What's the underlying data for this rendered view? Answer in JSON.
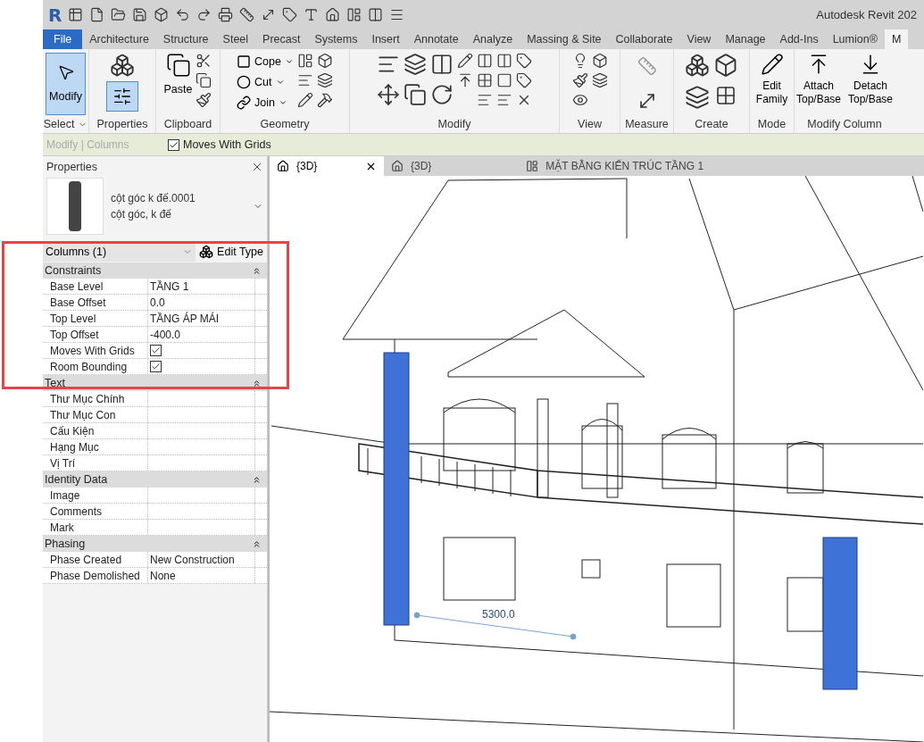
{
  "app": {
    "logo": "R",
    "title": "Autodesk Revit 202"
  },
  "ribbon_tabs": [
    {
      "label": "File",
      "kind": "file",
      "selected": false
    },
    {
      "label": "Architecture",
      "kind": "tab",
      "selected": false
    },
    {
      "label": "Structure",
      "kind": "tab",
      "selected": false
    },
    {
      "label": "Steel",
      "kind": "tab",
      "selected": false
    },
    {
      "label": "Precast",
      "kind": "tab",
      "selected": false
    },
    {
      "label": "Systems",
      "kind": "tab",
      "selected": false
    },
    {
      "label": "Insert",
      "kind": "tab",
      "selected": false
    },
    {
      "label": "Annotate",
      "kind": "tab",
      "selected": false
    },
    {
      "label": "Analyze",
      "kind": "tab",
      "selected": false
    },
    {
      "label": "Massing & Site",
      "kind": "tab",
      "selected": false
    },
    {
      "label": "Collaborate",
      "kind": "tab",
      "selected": false
    },
    {
      "label": "View",
      "kind": "tab",
      "selected": false
    },
    {
      "label": "Manage",
      "kind": "tab",
      "selected": false
    },
    {
      "label": "Add-Ins",
      "kind": "tab",
      "selected": false
    },
    {
      "label": "Lumion®",
      "kind": "tab",
      "selected": false
    },
    {
      "label": "M",
      "kind": "tab",
      "selected": true
    }
  ],
  "ribbon": {
    "modify_button": {
      "label": "Modify",
      "selected": true
    },
    "properties_button": {
      "selected": true
    },
    "paste_button": {
      "label": "Paste"
    },
    "geometry_tools": [
      "Cope",
      "Cut",
      "Join"
    ],
    "edit_family_button": {
      "label": "Edit\nFamily"
    },
    "column_buttons": [
      {
        "label": "Attach\nTop/Base"
      },
      {
        "label": "Detach\nTop/Base"
      }
    ],
    "panel_labels": [
      "Select",
      "Properties",
      "Clipboard",
      "Geometry",
      "Modify",
      "View",
      "Measure",
      "Create",
      "Mode",
      "Modify Column"
    ]
  },
  "context_bar": {
    "label": "Modify | Columns",
    "option": {
      "label": "Moves With Grids",
      "checked": true
    }
  },
  "properties": {
    "title": "Properties",
    "type_lines": [
      "cột góc k đế.0001",
      "cột góc, k đế"
    ],
    "selector": "Columns (1)",
    "edit_type": "Edit Type",
    "groups": [
      {
        "name": "Constraints",
        "expanded": true,
        "rows": [
          {
            "name": "Base Level",
            "kind": "text",
            "value": "TẦNG 1"
          },
          {
            "name": "Base Offset",
            "kind": "text",
            "value": "0.0"
          },
          {
            "name": "Top Level",
            "kind": "text",
            "value": "TẦNG ÁP MÁI"
          },
          {
            "name": "Top Offset",
            "kind": "text",
            "value": "-400.0"
          },
          {
            "name": "Moves With Grids",
            "kind": "check",
            "checked": true
          },
          {
            "name": "Room Bounding",
            "kind": "check",
            "checked": true
          }
        ]
      },
      {
        "name": "Text",
        "expanded": true,
        "rows": [
          {
            "name": "Thư Mục Chính",
            "kind": "text",
            "value": ""
          },
          {
            "name": "Thư Mục Con",
            "kind": "text",
            "value": ""
          },
          {
            "name": "Cấu Kiện",
            "kind": "text",
            "value": ""
          },
          {
            "name": "Hạng Mục",
            "kind": "text",
            "value": ""
          },
          {
            "name": "Vị Trí",
            "kind": "text",
            "value": ""
          }
        ]
      },
      {
        "name": "Identity Data",
        "expanded": true,
        "rows": [
          {
            "name": "Image",
            "kind": "text",
            "value": ""
          },
          {
            "name": "Comments",
            "kind": "text",
            "value": ""
          },
          {
            "name": "Mark",
            "kind": "text",
            "value": ""
          }
        ]
      },
      {
        "name": "Phasing",
        "expanded": true,
        "rows": [
          {
            "name": "Phase Created",
            "kind": "text",
            "value": "New Construction"
          },
          {
            "name": "Phase Demolished",
            "kind": "text",
            "value": "None"
          }
        ]
      }
    ]
  },
  "view_tabs": [
    {
      "label": "{3D}",
      "kind": "model",
      "selected": true
    },
    {
      "label": "{3D}",
      "kind": "model",
      "selected": false
    },
    {
      "label": "MẶT BẰNG KIẾN TRÚC TẦNG 1",
      "kind": "plan",
      "selected": false
    }
  ],
  "viewport": {
    "dimension": "5300.0"
  }
}
